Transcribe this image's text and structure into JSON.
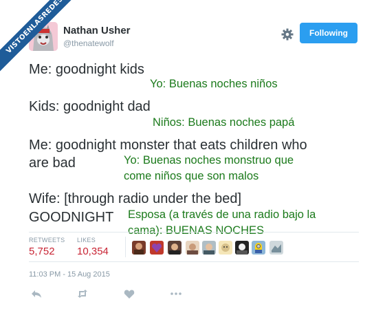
{
  "watermark": "VISTOENLASREDES",
  "user": {
    "name": "Nathan Usher",
    "handle": "@thenatewolf"
  },
  "follow_label": "Following",
  "tweet_lines": [
    "Me: goodnight kids",
    "Kids: goodnight dad",
    "Me: goodnight monster that eats children who",
    "are bad",
    "Wife: [through radio under the bed]",
    "GOODNIGHT"
  ],
  "translations": [
    "Yo: Buenas noches niños",
    "Niños: Buenas noches papá",
    "Yo: Buenas noches monstruo que",
    "come niños que son malos",
    "Esposa (a través de una radio bajo la",
    "cama): BUENAS NOCHES"
  ],
  "stats": {
    "retweets_label": "RETWEETS",
    "retweets": "5,752",
    "likes_label": "LIKES",
    "likes": "10,354"
  },
  "timestamp": "11:03 PM - 15 Aug 2015",
  "colors": {
    "accent": "#2b9ef0",
    "translation": "#1b7a1b",
    "count": "#c82333",
    "ribbon": "#1f5c99"
  },
  "icons": [
    "gear-icon",
    "reply-icon",
    "retweet-icon",
    "like-icon",
    "more-icon"
  ]
}
